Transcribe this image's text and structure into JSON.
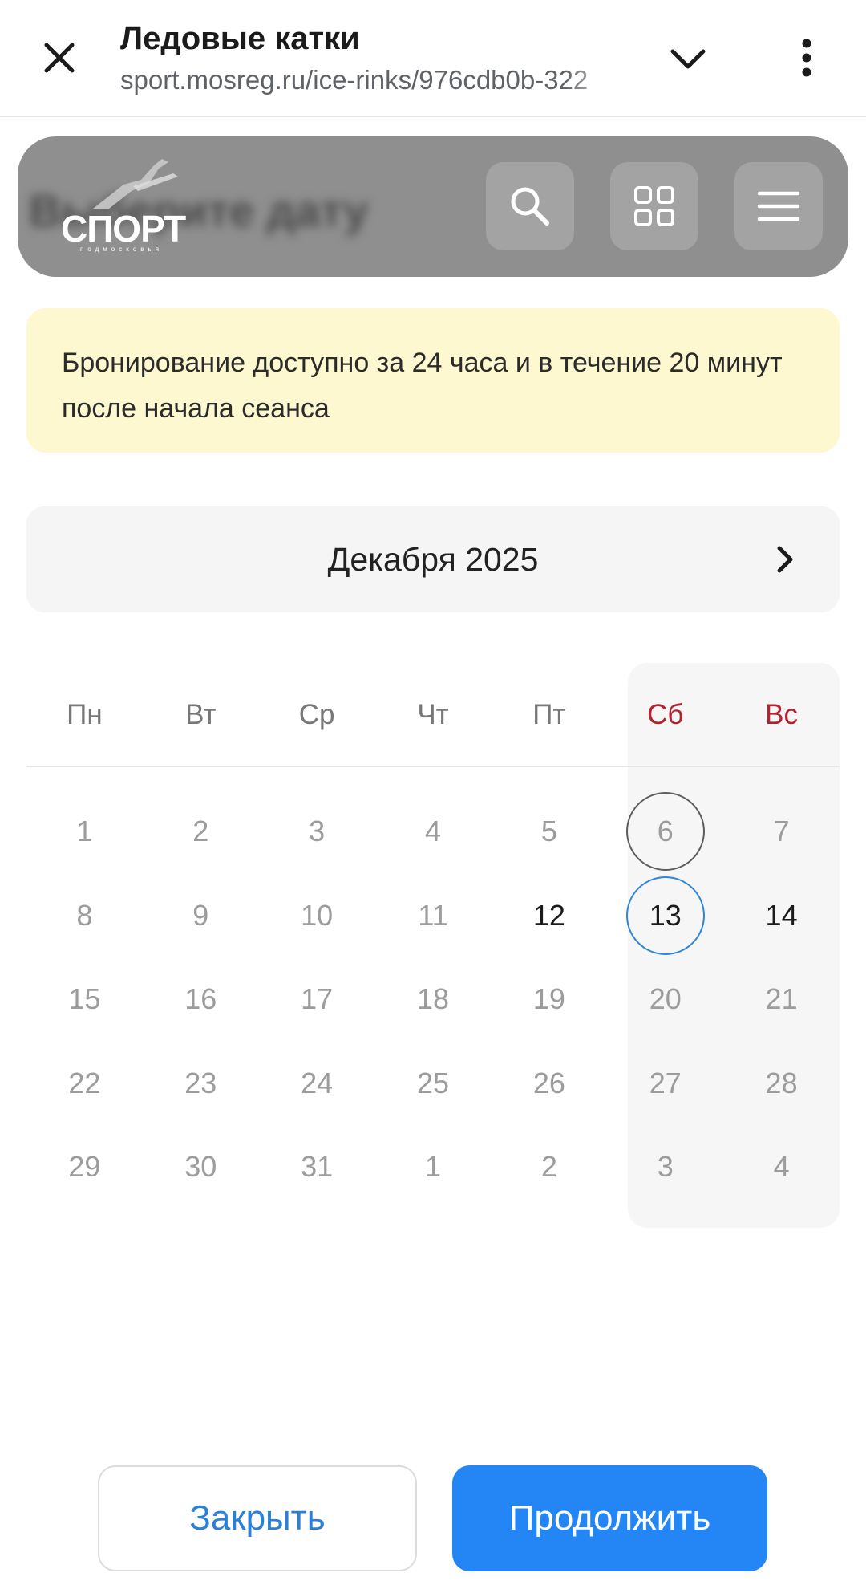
{
  "browser": {
    "title": "Ледовые катки",
    "url": "sport.mosreg.ru/ice-rinks/976cdb0b-322",
    "icons": {
      "close": "close-icon",
      "collapse": "chevron-down-icon",
      "menu": "more-vert-icon"
    }
  },
  "site_header": {
    "logo_text": "СПОРТ",
    "logo_subtext": "подмосковья",
    "icons": [
      "search-icon",
      "grid-icon",
      "hamburger-menu-icon"
    ]
  },
  "notice": {
    "text": "Бронирование доступно за 24 часа и в течение 20 минут после начала сеанса"
  },
  "calendar": {
    "month_label": "Декабря 2025",
    "weekdays": [
      "Пн",
      "Вт",
      "Ср",
      "Чт",
      "Пт",
      "Сб",
      "Вс"
    ],
    "weeks": [
      [
        "1",
        "2",
        "3",
        "4",
        "5",
        "6",
        "7"
      ],
      [
        "8",
        "9",
        "10",
        "11",
        "12",
        "13",
        "14"
      ],
      [
        "15",
        "16",
        "17",
        "18",
        "19",
        "20",
        "21"
      ],
      [
        "22",
        "23",
        "24",
        "25",
        "26",
        "27",
        "28"
      ],
      [
        "29",
        "30",
        "31",
        "1",
        "2",
        "3",
        "4"
      ]
    ],
    "today": "6",
    "selected": "13",
    "available": [
      "12",
      "13",
      "14"
    ]
  },
  "actions": {
    "close_label": "Закрыть",
    "continue_label": "Продолжить"
  },
  "colors": {
    "accent": "#2486f4",
    "weekend": "#b5212f",
    "notice_bg": "#fdf8cf"
  }
}
